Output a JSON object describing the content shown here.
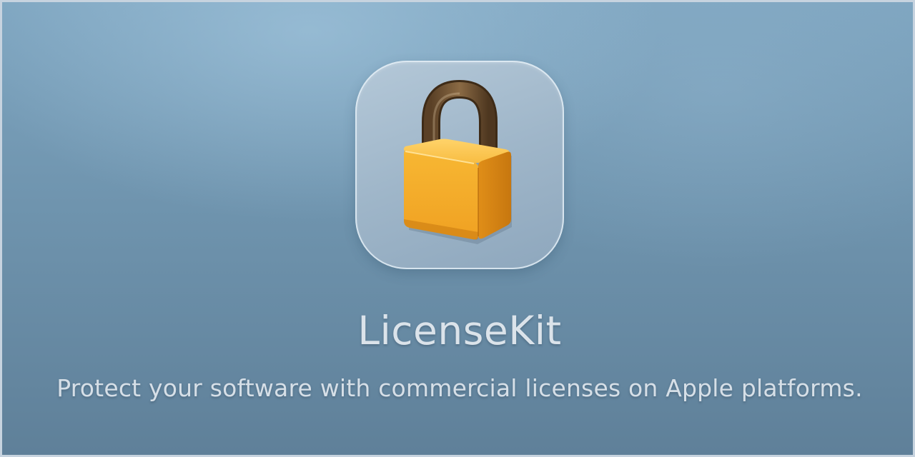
{
  "app": {
    "name": "LicenseKit",
    "tagline": "Protect your software with commercial licenses on Apple platforms."
  },
  "icon": {
    "name": "padlock-icon",
    "body_color": "#f2ac2b",
    "shackle_color": "#6b5030",
    "tile_color": "#a6bccf"
  },
  "colors": {
    "background": "#6f94ae",
    "text": "#dbe3ea"
  }
}
